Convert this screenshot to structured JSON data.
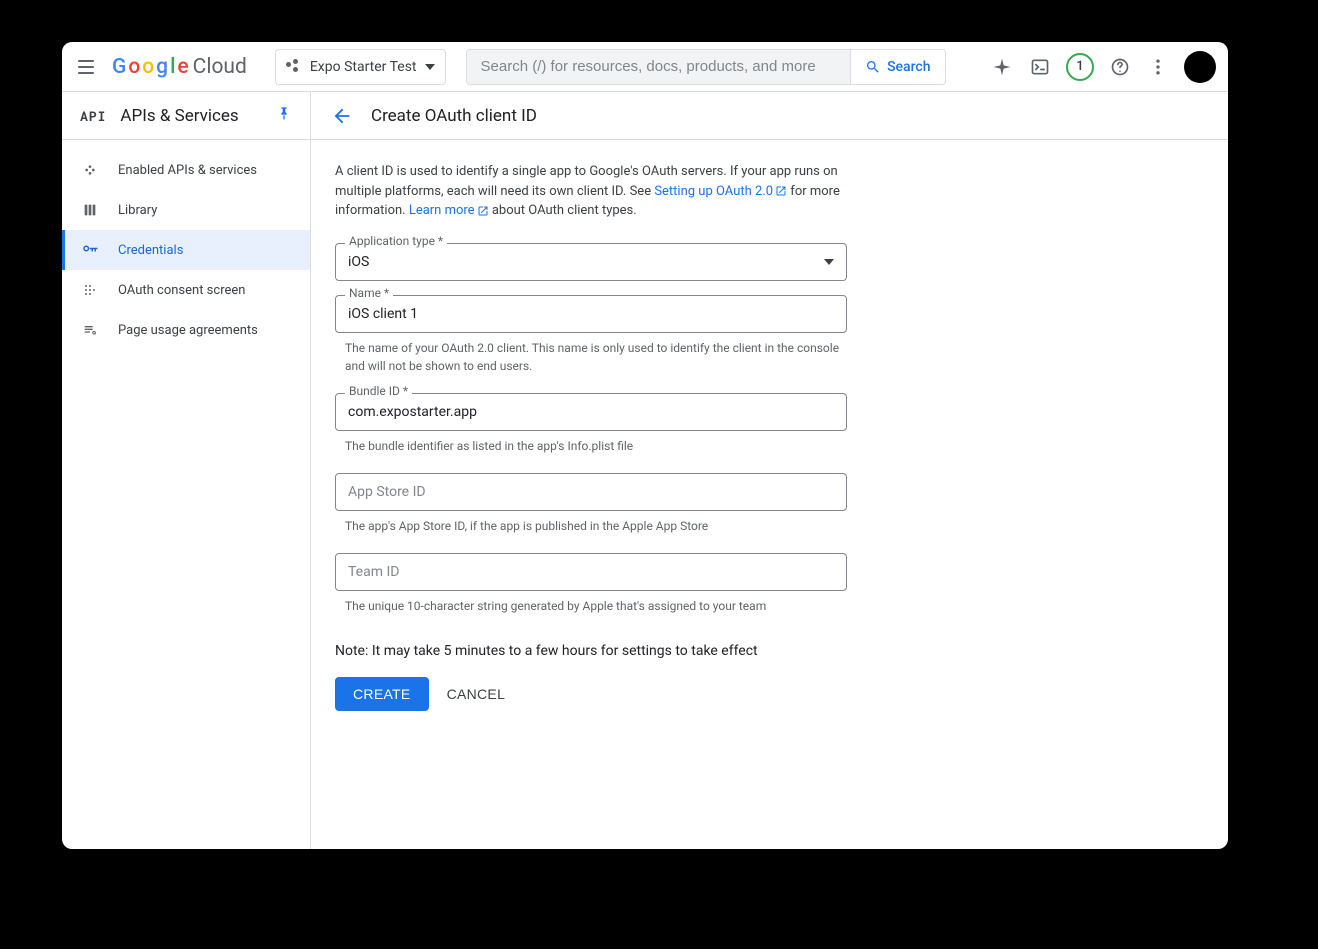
{
  "topbar": {
    "project_name": "Expo Starter Test",
    "search_placeholder": "Search (/) for resources, docs, products, and more",
    "search_button": "Search",
    "notification_count": "1"
  },
  "sidebar": {
    "section_title": "APIs & Services",
    "items": [
      {
        "label": "Enabled APIs & services"
      },
      {
        "label": "Library"
      },
      {
        "label": "Credentials"
      },
      {
        "label": "OAuth consent screen"
      },
      {
        "label": "Page usage agreements"
      }
    ]
  },
  "page": {
    "title": "Create OAuth client ID",
    "intro_part1": "A client ID is used to identify a single app to Google's OAuth servers. If your app runs on multiple platforms, each will need its own client ID. See ",
    "intro_link1": "Setting up OAuth 2.0",
    "intro_part2": " for more information. ",
    "intro_link2": "Learn more",
    "intro_part3": " about OAuth client types."
  },
  "form": {
    "app_type_label": "Application type *",
    "app_type_value": "iOS",
    "name_label": "Name *",
    "name_value": "iOS client 1",
    "name_helper": "The name of your OAuth 2.0 client. This name is only used to identify the client in the console and will not be shown to end users.",
    "bundle_label": "Bundle ID *",
    "bundle_value": "com.expostarter.app",
    "bundle_helper": "The bundle identifier as listed in the app's Info.plist file",
    "appstore_label": "App Store ID",
    "appstore_value": "",
    "appstore_placeholder": "App Store ID",
    "appstore_helper": "The app's App Store ID, if the app is published in the Apple App Store",
    "team_label": "Team ID",
    "team_value": "",
    "team_placeholder": "Team ID",
    "team_helper": "The unique 10-character string generated by Apple that's assigned to your team",
    "note": "Note: It may take 5 minutes to a few hours for settings to take effect",
    "create_button": "CREATE",
    "cancel_button": "CANCEL"
  }
}
